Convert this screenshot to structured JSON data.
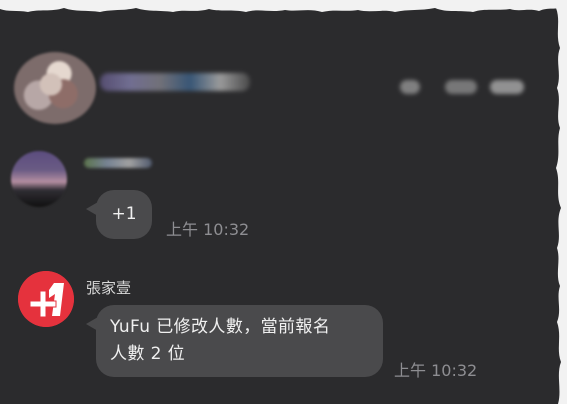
{
  "chat": {
    "messages": [
      {
        "text": "+1",
        "time": "上午 10:32"
      },
      {
        "sender": "張家壹",
        "text_line_1": "YuFu 已修改人數，當前報名",
        "text_line_2": "人數 2 位",
        "time": "上午 10:32"
      }
    ]
  },
  "colors": {
    "background": "#2b2b2d",
    "bubble": "#4a4a4c",
    "brand_red": "#e5323d",
    "timestamp": "#8e8e92"
  },
  "icons": {
    "brand_avatar": "plus-one-logo"
  }
}
